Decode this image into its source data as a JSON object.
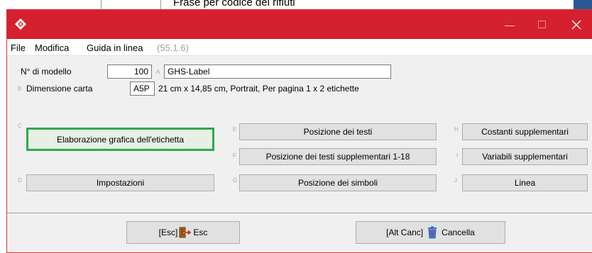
{
  "background_window": {
    "text": "Frase per codice dei rifiuti"
  },
  "titlebar": {
    "minimize_glyph": "—",
    "maximize_glyph": "☐",
    "close_glyph": "✕",
    "accent_color": "#d4202f"
  },
  "menu": {
    "file": "File",
    "modifica": "Modifica",
    "guida": "Guida in linea",
    "version": "(55.1.6)"
  },
  "form": {
    "model_label": "N° di modello",
    "model_number": "100",
    "hint_a": "A",
    "model_name": "GHS-Label",
    "hint_b": "B",
    "paper_label": "Dimensione carta",
    "paper_code": "A5P",
    "paper_desc": "21 cm x 14,85 cm, Portrait, Per pagina 1 x 2 etichette"
  },
  "buttons": {
    "hint_c": "C",
    "elaborazione": "Elaborazione grafica dell'etichetta",
    "hint_d": "D",
    "impostazioni": "Impostazioni",
    "hint_e": "E",
    "posizione_testi": "Posizione dei testi",
    "hint_f": "F",
    "posizione_testi_supp": "Posizione dei testi supplementari 1-18",
    "hint_g": "G",
    "posizione_simboli": "Posizione dei simboli",
    "hint_h": "H",
    "costanti": "Costanti supplementari",
    "hint_i": "I",
    "variabili": "Variabili supplementari",
    "hint_j": "J",
    "linea": "Linea"
  },
  "footer": {
    "esc_prefix": "[Esc]",
    "esc_label": "Esc",
    "cancel_prefix": "[Alt Canc]",
    "cancel_label": "Cancella"
  }
}
